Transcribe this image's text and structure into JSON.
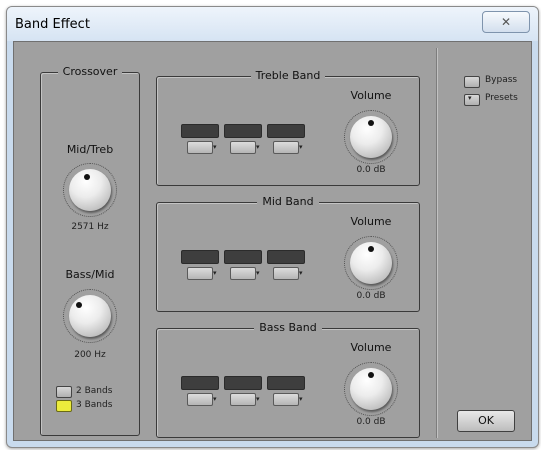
{
  "window": {
    "title": "Band Effect",
    "close_glyph": "✕"
  },
  "crossover": {
    "title": "Crossover",
    "mid_treb": {
      "label": "Mid/Treb",
      "value": "2571 Hz"
    },
    "bass_mid": {
      "label": "Bass/Mid",
      "value": "200 Hz"
    },
    "bands_2": "2 Bands",
    "bands_3": "3 Bands",
    "bands_selected": "3 Bands"
  },
  "treble": {
    "title": "Treble Band",
    "volume_label": "Volume",
    "volume_value": "0.0 dB"
  },
  "mid": {
    "title": "Mid Band",
    "volume_label": "Volume",
    "volume_value": "0.0 dB"
  },
  "bass": {
    "title": "Bass Band",
    "volume_label": "Volume",
    "volume_value": "0.0 dB"
  },
  "sidebar": {
    "bypass": "Bypass",
    "presets": "Presets",
    "dropdown_arrow": "▾"
  },
  "ok_label": "OK",
  "colors": {
    "panel": "#a0a0a0",
    "selected": "#ecec3c",
    "slot": "#3e3e3e"
  },
  "icons": [
    "close-icon",
    "knob-icon",
    "dropdown-arrow-icon",
    "checkbox-icon"
  ]
}
